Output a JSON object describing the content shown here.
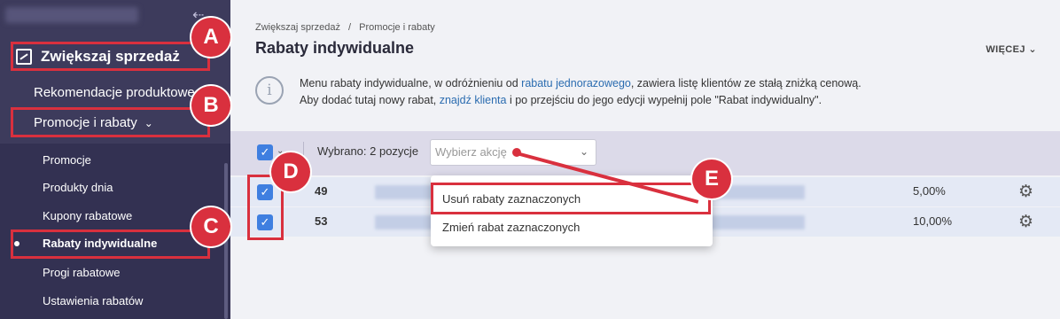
{
  "sidebar": {
    "section_label": "Zwiększaj sprzedaż",
    "items": [
      {
        "label": "Rekomendacje produktowe"
      },
      {
        "label": "Promocje i rabaty"
      }
    ],
    "subitems": [
      {
        "label": "Promocje"
      },
      {
        "label": "Produkty dnia"
      },
      {
        "label": "Kupony rabatowe"
      },
      {
        "label": "Rabaty indywidualne"
      },
      {
        "label": "Progi rabatowe"
      },
      {
        "label": "Ustawienia rabatów"
      }
    ]
  },
  "breadcrumb": {
    "parent": "Zwiększaj sprzedaż",
    "separator": "/",
    "current": "Promocje i rabaty"
  },
  "page": {
    "title": "Rabaty indywidualne",
    "more_label": "WIĘCEJ"
  },
  "info": {
    "line1_a": "Menu rabaty indywidualne, w odróżnieniu od ",
    "link1": "rabatu jednorazowego",
    "line1_b": ", zawiera listę klientów ze stałą zniżką cenową.",
    "line2_a": "Aby dodać tutaj nowy rabat, ",
    "link2": "znajdź klienta",
    "line2_b": " i po przejściu do jego edycji wypełnij pole \"Rabat indywidualny\"."
  },
  "selection": {
    "count_label": "Wybrano: 2 pozycje",
    "select_placeholder": "Wybierz akcję"
  },
  "rows": [
    {
      "id": "49",
      "discount": "5,00%"
    },
    {
      "id": "53",
      "discount": "10,00%"
    }
  ],
  "dropdown": {
    "options": [
      "Usuń rabaty zaznaczonych",
      "Zmień rabat zaznaczonych"
    ]
  },
  "annotations": [
    "A",
    "B",
    "C",
    "D",
    "E"
  ],
  "colors": {
    "sidebar": "#3d3b5c",
    "accent": "#3f7fe0",
    "annotation": "#d9303e"
  }
}
